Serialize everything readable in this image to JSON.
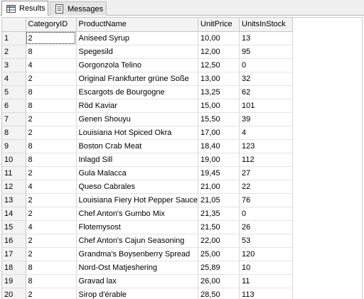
{
  "tabs": [
    {
      "label": "Results",
      "icon": "grid-icon"
    },
    {
      "label": "Messages",
      "icon": "messages-icon"
    }
  ],
  "columns": [
    "",
    "CategoryID",
    "ProductName",
    "UnitPrice",
    "UnitsInStock"
  ],
  "rows": [
    [
      "1",
      "2",
      "Aniseed Syrup",
      "10,00",
      "13"
    ],
    [
      "2",
      "8",
      "Spegesild",
      "12,00",
      "95"
    ],
    [
      "3",
      "4",
      "Gorgonzola Telino",
      "12,50",
      "0"
    ],
    [
      "4",
      "2",
      "Original Frankfurter grüne Soße",
      "13,00",
      "32"
    ],
    [
      "5",
      "8",
      "Escargots de Bourgogne",
      "13,25",
      "62"
    ],
    [
      "6",
      "8",
      "Röd Kaviar",
      "15,00",
      "101"
    ],
    [
      "7",
      "2",
      "Genen Shouyu",
      "15,50",
      "39"
    ],
    [
      "8",
      "2",
      "Louisiana Hot Spiced Okra",
      "17,00",
      "4"
    ],
    [
      "9",
      "8",
      "Boston Crab Meat",
      "18,40",
      "123"
    ],
    [
      "10",
      "8",
      "Inlagd Sill",
      "19,00",
      "112"
    ],
    [
      "11",
      "2",
      "Gula Malacca",
      "19,45",
      "27"
    ],
    [
      "12",
      "4",
      "Queso Cabrales",
      "21,00",
      "22"
    ],
    [
      "13",
      "2",
      "Louisiana Fiery Hot Pepper Sauce",
      "21,05",
      "76"
    ],
    [
      "14",
      "2",
      "Chef Anton's Gumbo Mix",
      "21,35",
      "0"
    ],
    [
      "15",
      "4",
      "Flotemysost",
      "21,50",
      "26"
    ],
    [
      "16",
      "2",
      "Chef Anton's Cajun Seasoning",
      "22,00",
      "53"
    ],
    [
      "17",
      "2",
      "Grandma's Boysenberry Spread",
      "25,00",
      "120"
    ],
    [
      "18",
      "8",
      "Nord-Ost Matjeshering",
      "25,89",
      "10"
    ],
    [
      "19",
      "8",
      "Gravad lax",
      "26,00",
      "11"
    ],
    [
      "20",
      "2",
      "Sirop d'érable",
      "28,50",
      "113"
    ]
  ],
  "selected_cell": {
    "row": 0,
    "col": 1
  }
}
